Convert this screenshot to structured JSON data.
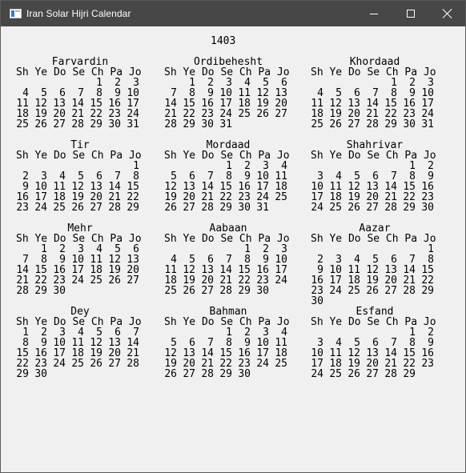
{
  "window": {
    "title": "Iran Solar Hijri Calendar",
    "minimize_icon": "minimize-icon",
    "maximize_icon": "maximize-icon",
    "close_icon": "close-icon"
  },
  "calendar": {
    "year": "1403",
    "weekday_header": "Sh Ye Do Se Ch Pa Jo",
    "months": [
      {
        "name": "Farvardin",
        "weeks": [
          [
            "",
            "",
            "",
            "",
            "1",
            "2",
            "3"
          ],
          [
            "4",
            "5",
            "6",
            "7",
            "8",
            "9",
            "10"
          ],
          [
            "11",
            "12",
            "13",
            "14",
            "15",
            "16",
            "17"
          ],
          [
            "18",
            "19",
            "20",
            "21",
            "22",
            "23",
            "24"
          ],
          [
            "25",
            "26",
            "27",
            "28",
            "29",
            "30",
            "31"
          ]
        ]
      },
      {
        "name": "Ordibehesht",
        "weeks": [
          [
            "",
            "1",
            "2",
            "3",
            "4",
            "5",
            "6"
          ],
          [
            "7",
            "8",
            "9",
            "10",
            "11",
            "12",
            "13"
          ],
          [
            "14",
            "15",
            "16",
            "17",
            "18",
            "19",
            "20"
          ],
          [
            "21",
            "22",
            "23",
            "24",
            "25",
            "26",
            "27"
          ],
          [
            "28",
            "29",
            "30",
            "31",
            "",
            "",
            ""
          ]
        ]
      },
      {
        "name": "Khordaad",
        "weeks": [
          [
            "",
            "",
            "",
            "",
            "1",
            "2",
            "3"
          ],
          [
            "4",
            "5",
            "6",
            "7",
            "8",
            "9",
            "10"
          ],
          [
            "11",
            "12",
            "13",
            "14",
            "15",
            "16",
            "17"
          ],
          [
            "18",
            "19",
            "20",
            "21",
            "22",
            "23",
            "24"
          ],
          [
            "25",
            "26",
            "27",
            "28",
            "29",
            "30",
            "31"
          ]
        ]
      },
      {
        "name": "Tir",
        "weeks": [
          [
            "",
            "",
            "",
            "",
            "",
            "",
            "1"
          ],
          [
            "2",
            "3",
            "4",
            "5",
            "6",
            "7",
            "8"
          ],
          [
            "9",
            "10",
            "11",
            "12",
            "13",
            "14",
            "15"
          ],
          [
            "16",
            "17",
            "18",
            "19",
            "20",
            "21",
            "22"
          ],
          [
            "23",
            "24",
            "25",
            "26",
            "27",
            "28",
            "29"
          ]
        ]
      },
      {
        "name": "Mordaad",
        "weeks": [
          [
            "",
            "",
            "",
            "1",
            "2",
            "3",
            "4"
          ],
          [
            "5",
            "6",
            "7",
            "8",
            "9",
            "10",
            "11"
          ],
          [
            "12",
            "13",
            "14",
            "15",
            "16",
            "17",
            "18"
          ],
          [
            "19",
            "20",
            "21",
            "22",
            "23",
            "24",
            "25"
          ],
          [
            "26",
            "27",
            "28",
            "29",
            "30",
            "31",
            ""
          ]
        ]
      },
      {
        "name": "Shahrivar",
        "weeks": [
          [
            "",
            "",
            "",
            "",
            "",
            "1",
            "2"
          ],
          [
            "3",
            "4",
            "5",
            "6",
            "7",
            "8",
            "9"
          ],
          [
            "10",
            "11",
            "12",
            "13",
            "14",
            "15",
            "16"
          ],
          [
            "17",
            "18",
            "19",
            "20",
            "21",
            "22",
            "23"
          ],
          [
            "24",
            "25",
            "26",
            "27",
            "28",
            "29",
            "30"
          ]
        ]
      },
      {
        "name": "Mehr",
        "weeks": [
          [
            "",
            "1",
            "2",
            "3",
            "4",
            "5",
            "6"
          ],
          [
            "7",
            "8",
            "9",
            "10",
            "11",
            "12",
            "13"
          ],
          [
            "14",
            "15",
            "16",
            "17",
            "18",
            "19",
            "20"
          ],
          [
            "21",
            "22",
            "23",
            "24",
            "25",
            "26",
            "27"
          ],
          [
            "28",
            "29",
            "30",
            "",
            "",
            "",
            ""
          ]
        ]
      },
      {
        "name": "Aabaan",
        "weeks": [
          [
            "",
            "",
            "",
            "",
            "1",
            "2",
            "3"
          ],
          [
            "4",
            "5",
            "6",
            "7",
            "8",
            "9",
            "10"
          ],
          [
            "11",
            "12",
            "13",
            "14",
            "15",
            "16",
            "17"
          ],
          [
            "18",
            "19",
            "20",
            "21",
            "22",
            "23",
            "24"
          ],
          [
            "25",
            "26",
            "27",
            "28",
            "29",
            "30",
            ""
          ]
        ]
      },
      {
        "name": "Aazar",
        "weeks": [
          [
            "",
            "",
            "",
            "",
            "",
            "",
            "1"
          ],
          [
            "2",
            "3",
            "4",
            "5",
            "6",
            "7",
            "8"
          ],
          [
            "9",
            "10",
            "11",
            "12",
            "13",
            "14",
            "15"
          ],
          [
            "16",
            "17",
            "18",
            "19",
            "20",
            "21",
            "22"
          ],
          [
            "23",
            "24",
            "25",
            "26",
            "27",
            "28",
            "29"
          ],
          [
            "30",
            "",
            "",
            "",
            "",
            "",
            ""
          ]
        ]
      },
      {
        "name": "Dey",
        "weeks": [
          [
            "1",
            "2",
            "3",
            "4",
            "5",
            "6",
            "7"
          ],
          [
            "8",
            "9",
            "10",
            "11",
            "12",
            "13",
            "14"
          ],
          [
            "15",
            "16",
            "17",
            "18",
            "19",
            "20",
            "21"
          ],
          [
            "22",
            "23",
            "24",
            "25",
            "26",
            "27",
            "28"
          ],
          [
            "29",
            "30",
            "",
            "",
            "",
            "",
            ""
          ]
        ]
      },
      {
        "name": "Bahman",
        "weeks": [
          [
            "",
            "",
            "",
            "1",
            "2",
            "3",
            "4"
          ],
          [
            "5",
            "6",
            "7",
            "8",
            "9",
            "10",
            "11"
          ],
          [
            "12",
            "13",
            "14",
            "15",
            "16",
            "17",
            "18"
          ],
          [
            "19",
            "20",
            "21",
            "22",
            "23",
            "24",
            "25"
          ],
          [
            "26",
            "27",
            "28",
            "29",
            "30",
            "",
            ""
          ]
        ]
      },
      {
        "name": "Esfand",
        "weeks": [
          [
            "",
            "",
            "",
            "",
            "",
            "1",
            "2"
          ],
          [
            "3",
            "4",
            "5",
            "6",
            "7",
            "8",
            "9"
          ],
          [
            "10",
            "11",
            "12",
            "13",
            "14",
            "15",
            "16"
          ],
          [
            "17",
            "18",
            "19",
            "20",
            "21",
            "22",
            "23"
          ],
          [
            "24",
            "25",
            "26",
            "27",
            "28",
            "29",
            ""
          ]
        ]
      }
    ]
  }
}
